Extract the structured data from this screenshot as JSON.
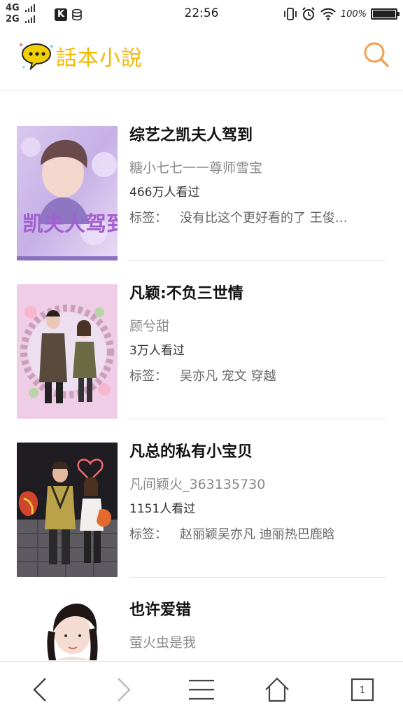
{
  "status_bar": {
    "network_1": "4G",
    "network_2": "2G",
    "app_icon_letter": "K",
    "time": "22:56",
    "battery_percent": "100%",
    "battery_level": 1.0
  },
  "header": {
    "app_name": "話本小說",
    "logo_color": "#f2b800",
    "search_icon_color": "#f0a050"
  },
  "books": [
    {
      "title": "综艺之凯夫人驾到",
      "author": "糖小七七一一尊师雪宝",
      "views": "466万人看过",
      "tag_label": "标签：",
      "tags": "没有比这个更好看的了 王俊…",
      "cover_text": "凯夫人驾到"
    },
    {
      "title": "凡颖:不负三世情",
      "author": "顾兮甜",
      "views": "3万人看过",
      "tag_label": "标签：",
      "tags": "吴亦凡 宠文 穿越"
    },
    {
      "title": "凡总的私有小宝贝",
      "author": "凡间颖火_363135730",
      "views": "1151人看过",
      "tag_label": "标签：",
      "tags": "赵丽颖吴亦凡 迪丽热巴鹿晗"
    },
    {
      "title": "也许爱错",
      "author": "萤火虫是我",
      "views": "",
      "tag_label": "",
      "tags": ""
    }
  ],
  "bottom_nav": {
    "tab_count": "1",
    "icons": [
      "back-icon",
      "forward-icon",
      "menu-icon",
      "home-icon",
      "tabs-icon"
    ]
  }
}
